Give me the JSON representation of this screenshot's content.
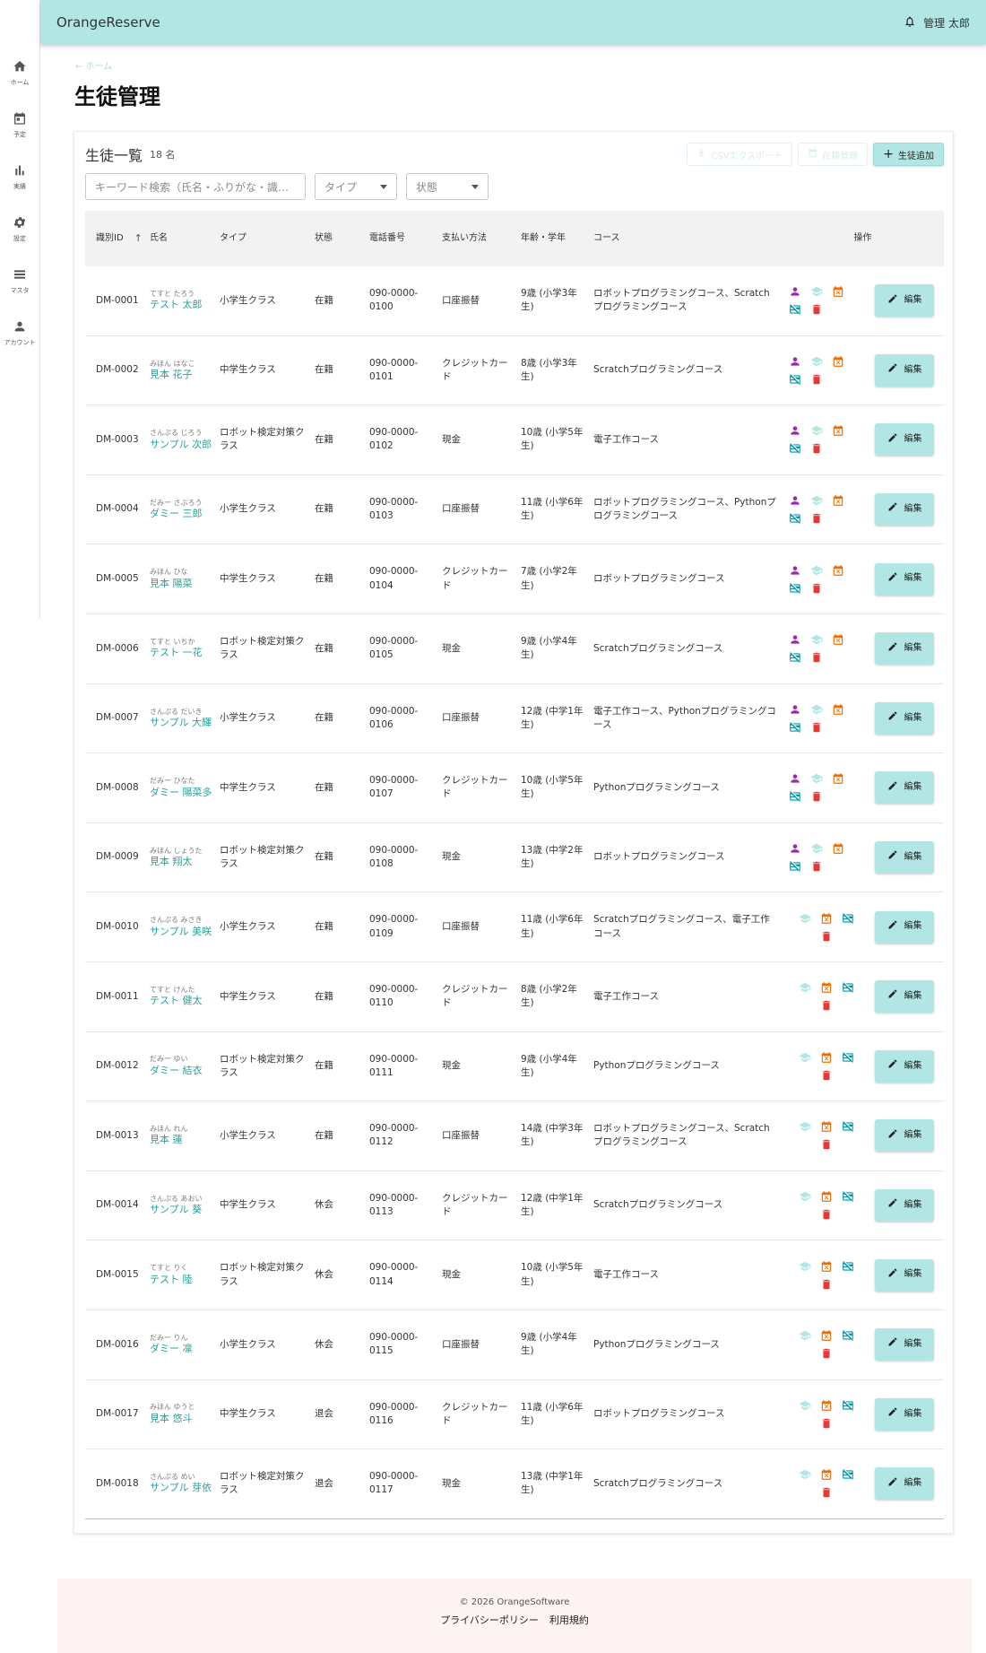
{
  "app": {
    "brand": "OrangeReserve",
    "user": "管理 太郎"
  },
  "sidebar": [
    {
      "label": "ホーム",
      "icon": "home-icon"
    },
    {
      "label": "予定",
      "icon": "calendar-icon"
    },
    {
      "label": "実績",
      "icon": "bar-chart-icon"
    },
    {
      "label": "設定",
      "icon": "gear-icon"
    },
    {
      "label": "マスタ",
      "icon": "list-icon"
    },
    {
      "label": "アカウント",
      "icon": "person-icon"
    }
  ],
  "breadcrumb": "← ホーム",
  "page_title": "生徒管理",
  "card": {
    "title": "生徒一覧",
    "count": "18 名",
    "csv_button": "CSVエクスポート",
    "enroll_button": "在籍管理",
    "add_button": "生徒追加"
  },
  "filters": {
    "search_placeholder": "キーワード検索（氏名・ふりがな・識…",
    "type_label": "タイプ",
    "status_label": "状態"
  },
  "columns": {
    "id": "識別ID",
    "name": "氏名",
    "type": "タイプ",
    "status": "状態",
    "phone": "電話番号",
    "payment": "支払い方法",
    "age": "年齢・学年",
    "course": "コース",
    "ops": "操作"
  },
  "edit_label": "編集",
  "colors": {
    "accent": "#b2e6e4",
    "name_link": "#2aa198",
    "purple": "#9c27b0",
    "orange": "#ef6c00",
    "red": "#e53935",
    "teal": "#0097a7"
  },
  "rows": [
    {
      "id": "DM-0001",
      "kana": "てすと たろう",
      "name": "テスト 太郎",
      "type": "小学生クラス",
      "status": "在籍",
      "phone": "090-0000-0100",
      "payment": "口座振替",
      "age": "9歳 (小学3年生)",
      "course": "ロボットプログラミングコース、Scratchプログラミングコース",
      "ops": "a"
    },
    {
      "id": "DM-0002",
      "kana": "みほん はなこ",
      "name": "見本 花子",
      "type": "中学生クラス",
      "status": "在籍",
      "phone": "090-0000-0101",
      "payment": "クレジットカード",
      "age": "8歳 (小学3年生)",
      "course": "Scratchプログラミングコース",
      "ops": "a"
    },
    {
      "id": "DM-0003",
      "kana": "さんぷる じろう",
      "name": "サンプル 次郎",
      "type": "ロボット検定対策クラス",
      "status": "在籍",
      "phone": "090-0000-0102",
      "payment": "現金",
      "age": "10歳 (小学5年生)",
      "course": "電子工作コース",
      "ops": "a"
    },
    {
      "id": "DM-0004",
      "kana": "だみー さぶろう",
      "name": "ダミー 三郎",
      "type": "小学生クラス",
      "status": "在籍",
      "phone": "090-0000-0103",
      "payment": "口座振替",
      "age": "11歳 (小学6年生)",
      "course": "ロボットプログラミングコース、Pythonプログラミングコース",
      "ops": "a"
    },
    {
      "id": "DM-0005",
      "kana": "みほん ひな",
      "name": "見本 陽菜",
      "type": "中学生クラス",
      "status": "在籍",
      "phone": "090-0000-0104",
      "payment": "クレジットカード",
      "age": "7歳 (小学2年生)",
      "course": "ロボットプログラミングコース",
      "ops": "a"
    },
    {
      "id": "DM-0006",
      "kana": "てすと いちか",
      "name": "テスト 一花",
      "type": "ロボット検定対策クラス",
      "status": "在籍",
      "phone": "090-0000-0105",
      "payment": "現金",
      "age": "9歳 (小学4年生)",
      "course": "Scratchプログラミングコース",
      "ops": "a"
    },
    {
      "id": "DM-0007",
      "kana": "さんぷる だいき",
      "name": "サンプル 大輝",
      "type": "小学生クラス",
      "status": "在籍",
      "phone": "090-0000-0106",
      "payment": "口座振替",
      "age": "12歳 (中学1年生)",
      "course": "電子工作コース、Pythonプログラミングコース",
      "ops": "a"
    },
    {
      "id": "DM-0008",
      "kana": "だみー ひなた",
      "name": "ダミー 陽菜多",
      "type": "中学生クラス",
      "status": "在籍",
      "phone": "090-0000-0107",
      "payment": "クレジットカード",
      "age": "10歳 (小学5年生)",
      "course": "Pythonプログラミングコース",
      "ops": "a"
    },
    {
      "id": "DM-0009",
      "kana": "みほん しょうた",
      "name": "見本 翔太",
      "type": "ロボット検定対策クラス",
      "status": "在籍",
      "phone": "090-0000-0108",
      "payment": "現金",
      "age": "13歳 (中学2年生)",
      "course": "ロボットプログラミングコース",
      "ops": "a"
    },
    {
      "id": "DM-0010",
      "kana": "さんぷる みさき",
      "name": "サンプル 美咲",
      "type": "小学生クラス",
      "status": "在籍",
      "phone": "090-0000-0109",
      "payment": "口座振替",
      "age": "11歳 (小学6年生)",
      "course": "Scratchプログラミングコース、電子工作コース",
      "ops": "b"
    },
    {
      "id": "DM-0011",
      "kana": "てすと けんた",
      "name": "テスト 健太",
      "type": "中学生クラス",
      "status": "在籍",
      "phone": "090-0000-0110",
      "payment": "クレジットカード",
      "age": "8歳 (小学2年生)",
      "course": "電子工作コース",
      "ops": "b"
    },
    {
      "id": "DM-0012",
      "kana": "だみー ゆい",
      "name": "ダミー 結衣",
      "type": "ロボット検定対策クラス",
      "status": "在籍",
      "phone": "090-0000-0111",
      "payment": "現金",
      "age": "9歳 (小学4年生)",
      "course": "Pythonプログラミングコース",
      "ops": "b"
    },
    {
      "id": "DM-0013",
      "kana": "みほん れん",
      "name": "見本 蓮",
      "type": "小学生クラス",
      "status": "在籍",
      "phone": "090-0000-0112",
      "payment": "口座振替",
      "age": "14歳 (中学3年生)",
      "course": "ロボットプログラミングコース、Scratchプログラミングコース",
      "ops": "b"
    },
    {
      "id": "DM-0014",
      "kana": "さんぷる あおい",
      "name": "サンプル 葵",
      "type": "中学生クラス",
      "status": "休会",
      "phone": "090-0000-0113",
      "payment": "クレジットカード",
      "age": "12歳 (中学1年生)",
      "course": "Scratchプログラミングコース",
      "ops": "b"
    },
    {
      "id": "DM-0015",
      "kana": "てすと りく",
      "name": "テスト 陸",
      "type": "ロボット検定対策クラス",
      "status": "休会",
      "phone": "090-0000-0114",
      "payment": "現金",
      "age": "10歳 (小学5年生)",
      "course": "電子工作コース",
      "ops": "b"
    },
    {
      "id": "DM-0016",
      "kana": "だみー りん",
      "name": "ダミー 凛",
      "type": "小学生クラス",
      "status": "休会",
      "phone": "090-0000-0115",
      "payment": "口座振替",
      "age": "9歳 (小学4年生)",
      "course": "Pythonプログラミングコース",
      "ops": "b"
    },
    {
      "id": "DM-0017",
      "kana": "みほん ゆうと",
      "name": "見本 悠斗",
      "type": "中学生クラス",
      "status": "退会",
      "phone": "090-0000-0116",
      "payment": "クレジットカード",
      "age": "11歳 (小学6年生)",
      "course": "ロボットプログラミングコース",
      "ops": "b"
    },
    {
      "id": "DM-0018",
      "kana": "さんぷる めい",
      "name": "サンプル 芽依",
      "type": "ロボット検定対策クラス",
      "status": "退会",
      "phone": "090-0000-0117",
      "payment": "現金",
      "age": "13歳 (中学1年生)",
      "course": "Scratchプログラミングコース",
      "ops": "b"
    }
  ],
  "footer": {
    "copyright": "© 2026 OrangeSoftware",
    "privacy": "プライバシーポリシー",
    "terms": "利用規約"
  }
}
